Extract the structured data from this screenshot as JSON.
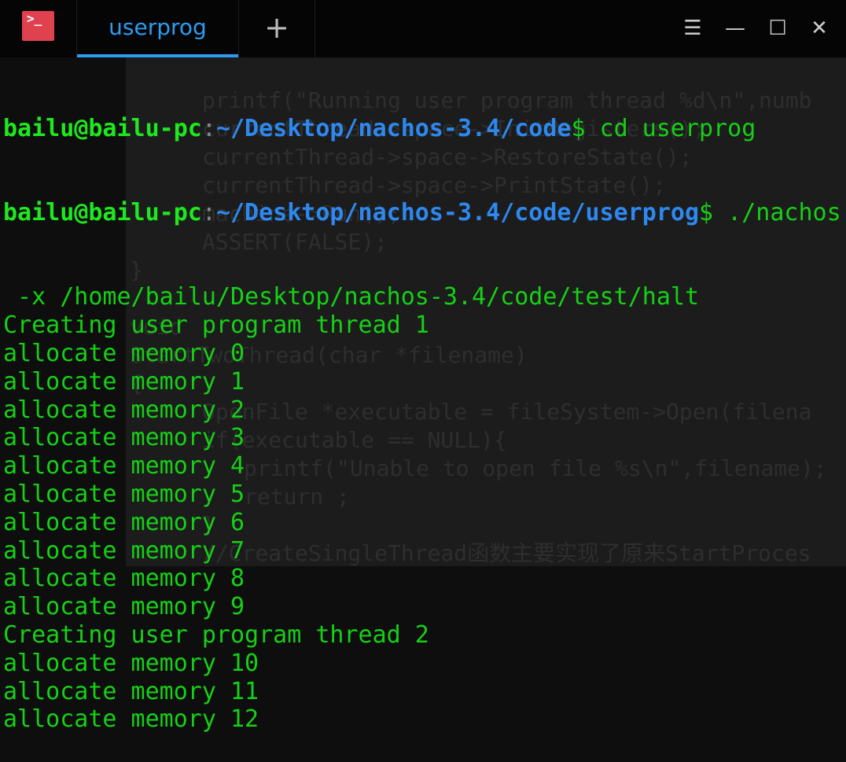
{
  "window": {
    "app_icon": ">_",
    "tab_label": "userprog",
    "new_tab": "+",
    "controls": {
      "menu": "☰",
      "minimize": "—",
      "maximize": "☐",
      "close": "✕"
    },
    "colors": {
      "accent": "#2d9cf0",
      "prompt_user": "#1ee81e",
      "prompt_path": "#2d88f0",
      "output": "#16d016",
      "app_icon": "#e0414f"
    }
  },
  "terminal": {
    "prompts": [
      {
        "user": "bailu@bailu-pc",
        "colon": ":",
        "path": "~/Desktop/nachos-3.4/code",
        "cmd": "$ cd userprog"
      },
      {
        "user": "bailu@bailu-pc",
        "colon": ":",
        "path": "~/Desktop/nachos-3.4/code/userprog",
        "cmd": "$ ./nachos"
      }
    ],
    "output": [
      " -x /home/bailu/Desktop/nachos-3.4/code/test/halt",
      "Creating user program thread 1",
      "allocate memory 0",
      "allocate memory 1",
      "allocate memory 2",
      "allocate memory 3",
      "allocate memory 4",
      "allocate memory 5",
      "allocate memory 6",
      "allocate memory 7",
      "allocate memory 8",
      "allocate memory 9",
      "Creating user program thread 2",
      "allocate memory 10",
      "allocate memory 11",
      "allocate memory 12"
    ]
  },
  "background_code": [
    {
      "row": 1,
      "indent": 1,
      "text": "printf(\"Running user program thread %d\\n\",numb"
    },
    {
      "row": 2,
      "indent": 1,
      "text": "currentThread->space->InitRegisters();"
    },
    {
      "row": 3,
      "indent": 1,
      "text": "currentThread->space->RestoreState();"
    },
    {
      "row": 4,
      "indent": 1,
      "text": "currentThread->space->PrintState();"
    },
    {
      "row": 5,
      "indent": 1,
      "text": "machine->Run();"
    },
    {
      "row": 6,
      "indent": 1,
      "text": "ASSERT(FALSE);"
    },
    {
      "row": 7,
      "indent": 0,
      "text": "}"
    },
    {
      "row": 9,
      "indent": 0,
      "text": "void"
    },
    {
      "row": 10,
      "indent": 0,
      "text": "StartTwoThread(char *filename)"
    },
    {
      "row": 11,
      "indent": 0,
      "text": "{"
    },
    {
      "row": 12,
      "indent": 1,
      "text": "OpenFile *executable = fileSystem->Open(filena"
    },
    {
      "row": 13,
      "indent": 1,
      "text": "if(executable == NULL){"
    },
    {
      "row": 14,
      "indent": 2,
      "text": "printf(\"Unable to open file %s\\n\",filename);"
    },
    {
      "row": 15,
      "indent": 2,
      "text": "return ;"
    },
    {
      "row": 16,
      "indent": 1,
      "text": "}"
    },
    {
      "row": 17,
      "indent": 1,
      "text": "//CreateSingleThread函数主要实现了原来StartProces"
    }
  ]
}
